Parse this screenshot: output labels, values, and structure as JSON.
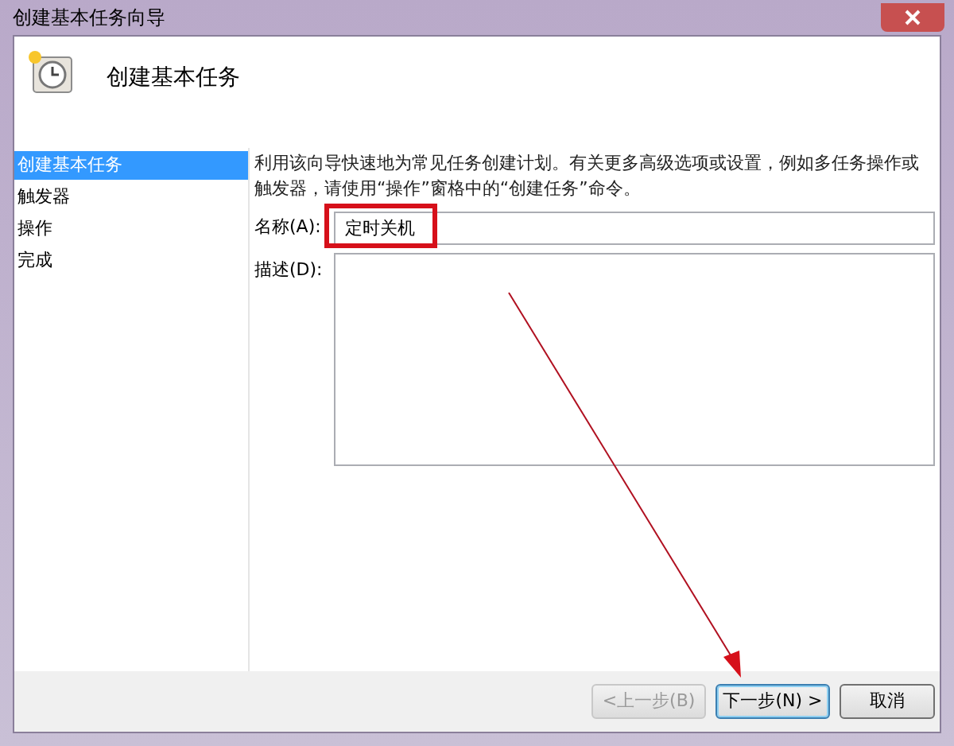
{
  "window": {
    "title": "创建基本任务向导"
  },
  "header": {
    "title": "创建基本任务"
  },
  "steps": [
    {
      "label": "创建基本任务",
      "selected": true
    },
    {
      "label": "触发器",
      "selected": false
    },
    {
      "label": "操作",
      "selected": false
    },
    {
      "label": "完成",
      "selected": false
    }
  ],
  "intro": "利用该向导快速地为常见任务创建计划。有关更多高级选项或设置，例如多任务操作或触发器，请使用“操作”窗格中的“创建任务”命令。",
  "name_field": {
    "label": "名称(A):",
    "value": "定时关机"
  },
  "description_field": {
    "label": "描述(D):"
  },
  "buttons": [
    {
      "label": "<上一步(B)",
      "disabled": true,
      "default": false
    },
    {
      "label": "下一步(N) >",
      "disabled": false,
      "default": true
    },
    {
      "label": "取消",
      "disabled": false,
      "default": false
    }
  ]
}
